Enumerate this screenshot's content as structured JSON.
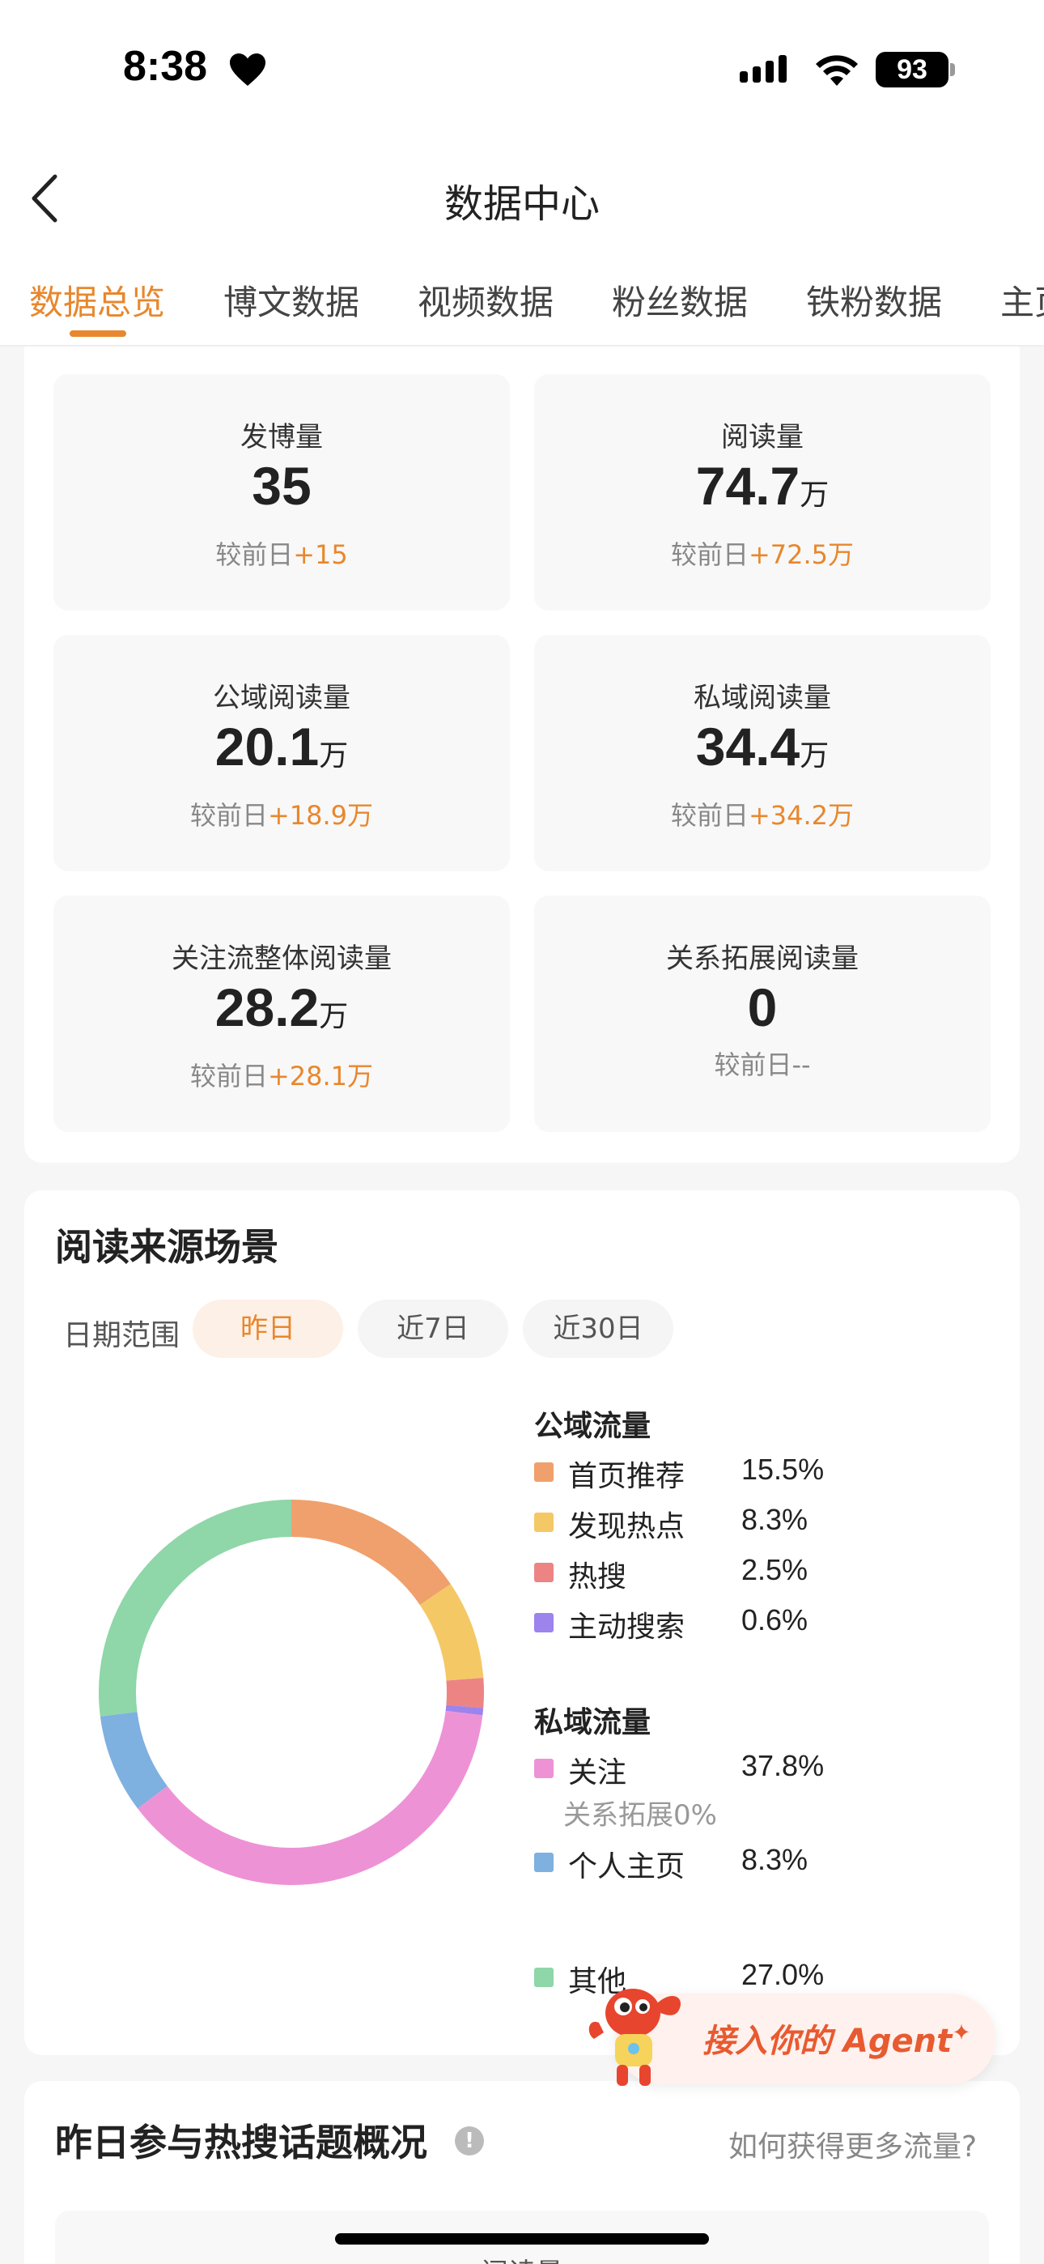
{
  "status_bar": {
    "time": "8:38",
    "battery": "93"
  },
  "header": {
    "title": "数据中心"
  },
  "tabs": [
    {
      "label": "数据总览",
      "active": true
    },
    {
      "label": "博文数据"
    },
    {
      "label": "视频数据"
    },
    {
      "label": "粉丝数据"
    },
    {
      "label": "铁粉数据"
    },
    {
      "label": "主页"
    }
  ],
  "stats": [
    {
      "label": "发博量",
      "value": "35",
      "unit": "",
      "cmp_label": "较前日",
      "delta": "+15"
    },
    {
      "label": "阅读量",
      "value": "74.7",
      "unit": "万",
      "cmp_label": "较前日",
      "delta": "+72.5万"
    },
    {
      "label": "公域阅读量",
      "value": "20.1",
      "unit": "万",
      "cmp_label": "较前日",
      "delta": "+18.9万"
    },
    {
      "label": "私域阅读量",
      "value": "34.4",
      "unit": "万",
      "cmp_label": "较前日",
      "delta": "+34.2万"
    },
    {
      "label": "关注流整体阅读量",
      "value": "28.2",
      "unit": "万",
      "cmp_label": "较前日",
      "delta": "+28.1万"
    },
    {
      "label": "关系拓展阅读量",
      "value": "0",
      "unit": "",
      "cmp_label": "较前日--",
      "delta": ""
    }
  ],
  "source_section": {
    "title": "阅读来源场景",
    "range_label": "日期范围",
    "ranges": [
      "昨日",
      "近7日",
      "近30日"
    ],
    "public_title": "公域流量",
    "private_title": "私域流量",
    "relation_note": "关系拓展0%"
  },
  "chart_data": {
    "type": "pie",
    "donut": true,
    "slices": [
      {
        "name": "首页推荐",
        "value": 15.5,
        "label": "15.5%",
        "color": "#f0a06c"
      },
      {
        "name": "发现热点",
        "value": 8.3,
        "label": "8.3%",
        "color": "#f5c866"
      },
      {
        "name": "热搜",
        "value": 2.5,
        "label": "2.5%",
        "color": "#ec8484"
      },
      {
        "name": "主动搜索",
        "value": 0.6,
        "label": "0.6%",
        "color": "#9d83ec"
      },
      {
        "name": "关注",
        "value": 37.8,
        "label": "37.8%",
        "color": "#ee92d6"
      },
      {
        "name": "个人主页",
        "value": 8.3,
        "label": "8.3%",
        "color": "#7eb0e0"
      },
      {
        "name": "其他",
        "value": 27.0,
        "label": "27.0%",
        "color": "#8fd6a9"
      }
    ]
  },
  "hot_section": {
    "title": "昨日参与热搜话题概况",
    "more_link": "如何获得更多流量?",
    "sub_label": "阅读量"
  },
  "agent_button": {
    "label": "接入你的 Agent"
  },
  "colors": {
    "accent": "#e8872d"
  }
}
